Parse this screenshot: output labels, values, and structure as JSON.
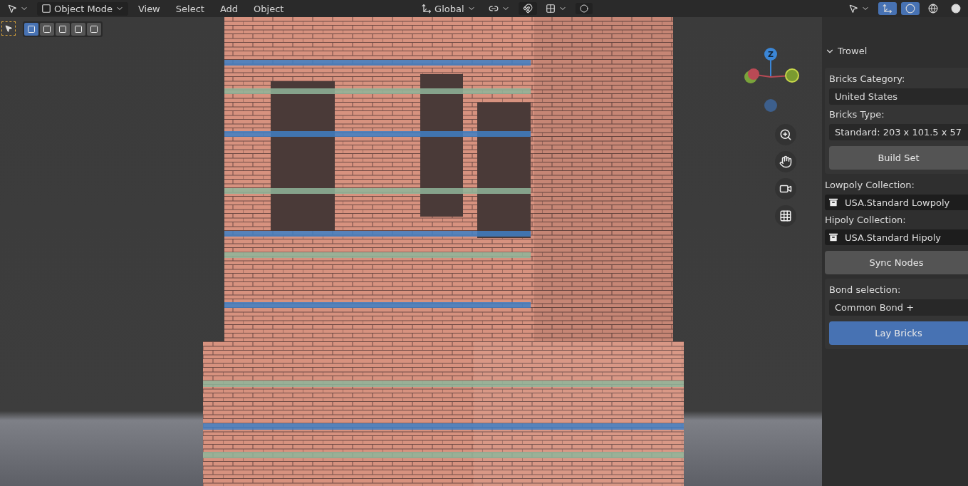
{
  "header": {
    "mode": "Object Mode",
    "menus": [
      "View",
      "Select",
      "Add",
      "Object"
    ],
    "orientation": "Global"
  },
  "select_modes": [
    {
      "selected": true
    },
    {
      "selected": false
    },
    {
      "selected": false
    },
    {
      "selected": false
    },
    {
      "selected": false
    }
  ],
  "gizmo": {
    "axis_label": "Z"
  },
  "panel": {
    "title": "Trowel",
    "expanded": true,
    "groups": [
      {
        "boxed": true,
        "items": [
          {
            "kind": "label",
            "text": "Bricks Category:"
          },
          {
            "kind": "dropdown",
            "text": "United States"
          },
          {
            "kind": "label",
            "text": "Bricks Type:"
          },
          {
            "kind": "dropdown",
            "text": "Standard: 203 x 101.5 x 57"
          },
          {
            "kind": "button",
            "text": "Build Set"
          }
        ]
      },
      {
        "boxed": false,
        "items": [
          {
            "kind": "label",
            "text": "Lowpoly Collection:"
          },
          {
            "kind": "collection",
            "text": "USA.Standard Lowpoly"
          },
          {
            "kind": "label",
            "text": "Hipoly Collection:"
          },
          {
            "kind": "collection",
            "text": "USA.Standard Hipoly"
          },
          {
            "kind": "button",
            "text": "Sync Nodes"
          }
        ]
      },
      {
        "boxed": true,
        "items": [
          {
            "kind": "label",
            "text": "Bond selection:"
          },
          {
            "kind": "dropdown",
            "text": "Common Bond +"
          },
          {
            "kind": "primary",
            "text": "Lay Bricks"
          }
        ]
      }
    ]
  }
}
